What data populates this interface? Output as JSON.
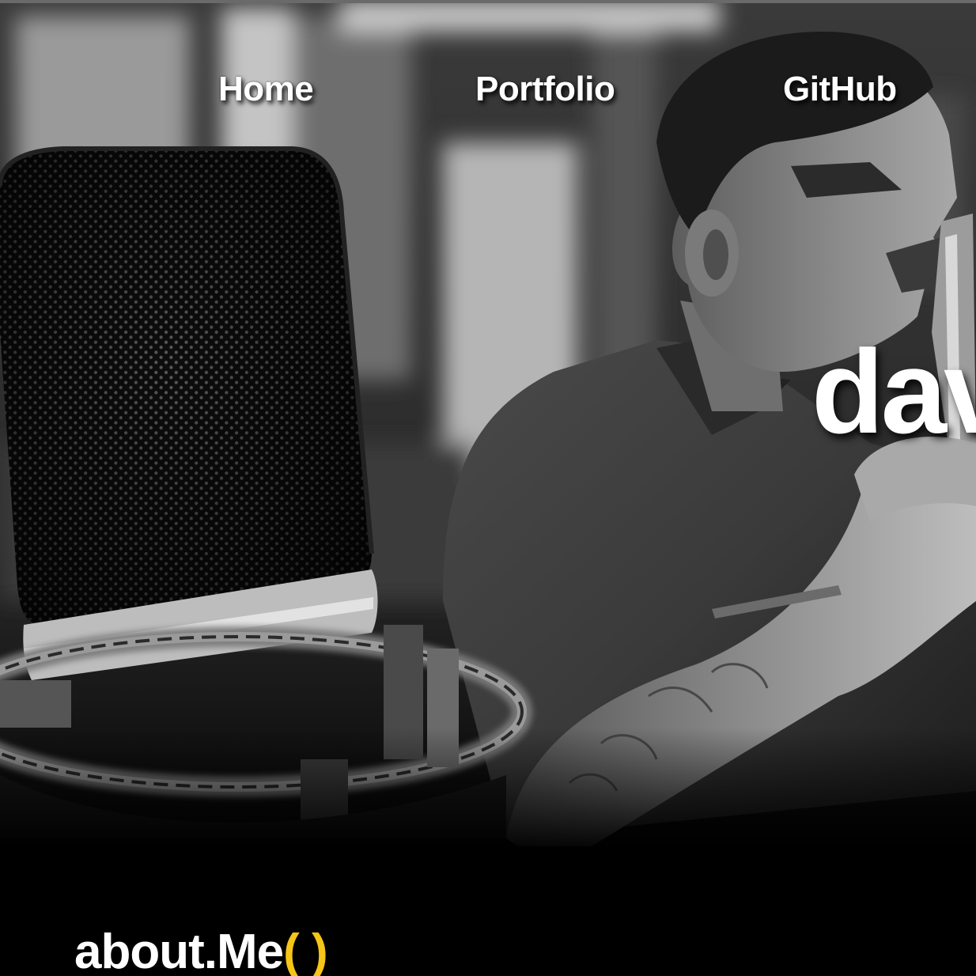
{
  "nav": {
    "home_label": "Home",
    "portfolio_label": "Portfolio",
    "github_label": "GitHub"
  },
  "hero": {
    "name_partial": "dav"
  },
  "about": {
    "heading_main": "about.Me",
    "heading_parens": "( )"
  },
  "colors": {
    "accent": "#f5c518",
    "text": "#ffffff",
    "background": "#000000"
  },
  "images": {
    "hero_photo": "black-and-white-microphone-and-man-with-instrument"
  }
}
